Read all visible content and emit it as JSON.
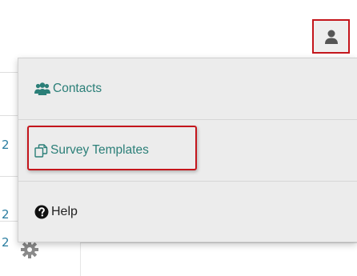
{
  "background": {
    "left_fragments": [
      "2",
      "2",
      "2"
    ],
    "settings_icon": "gear-icon"
  },
  "user_menu": {
    "trigger_icon": "user-icon",
    "items": [
      {
        "label": "Contacts",
        "icon": "users-icon"
      },
      {
        "label": "Survey Templates",
        "icon": "copy-icon"
      },
      {
        "label": "Help",
        "icon": "question-circle-icon"
      }
    ]
  },
  "colors": {
    "accent": "#2b7f78",
    "highlight": "#c4161c",
    "menu_bg": "#ececec"
  }
}
